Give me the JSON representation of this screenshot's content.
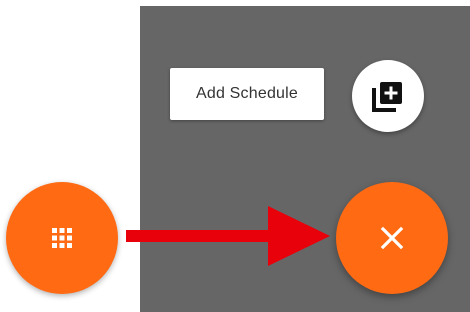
{
  "colors": {
    "accent": "#ff6a13",
    "overlay": "#666666",
    "arrow": "#e8000b",
    "icon_dark": "#111111"
  },
  "speed_dial": {
    "action_label": "Add Schedule",
    "action_icon": "add-to-library-icon",
    "toggle_closed_icon": "grid-icon",
    "toggle_open_icon": "close-icon"
  },
  "annotation": {
    "arrow_icon": "arrow-right-icon"
  }
}
